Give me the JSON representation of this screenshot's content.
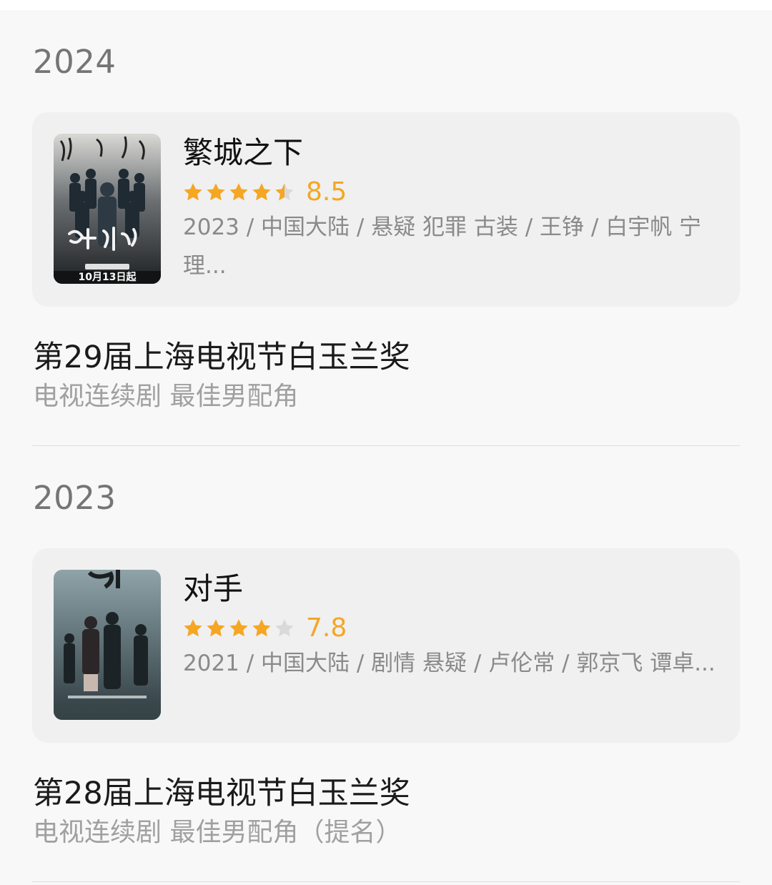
{
  "colors": {
    "background": "#f8f8f8",
    "card": "#f0f0f0",
    "star_filled": "#f5a623",
    "star_empty": "#d9d9d9",
    "year_text": "#757575",
    "meta_text": "#8a8a8a"
  },
  "entries": [
    {
      "year": "2024",
      "show": {
        "title": "繁城之下",
        "rating_stars": 4.5,
        "score": "8.5",
        "meta": "2023 / 中国大陆 / 悬疑 犯罪 古装 / 王铮 / 白宇帆 宁理...",
        "poster_caption": "10月13日起"
      },
      "award": {
        "name": "第29届上海电视节白玉兰奖",
        "category": "电视连续剧 最佳男配角"
      }
    },
    {
      "year": "2023",
      "show": {
        "title": "对手",
        "rating_stars": 4,
        "score": "7.8",
        "meta": "2021 / 中国大陆 / 剧情 悬疑 / 卢伦常 / 郭京飞 谭卓...",
        "poster_caption": ""
      },
      "award": {
        "name": "第28届上海电视节白玉兰奖",
        "category": "电视连续剧 最佳男配角（提名）"
      }
    }
  ]
}
